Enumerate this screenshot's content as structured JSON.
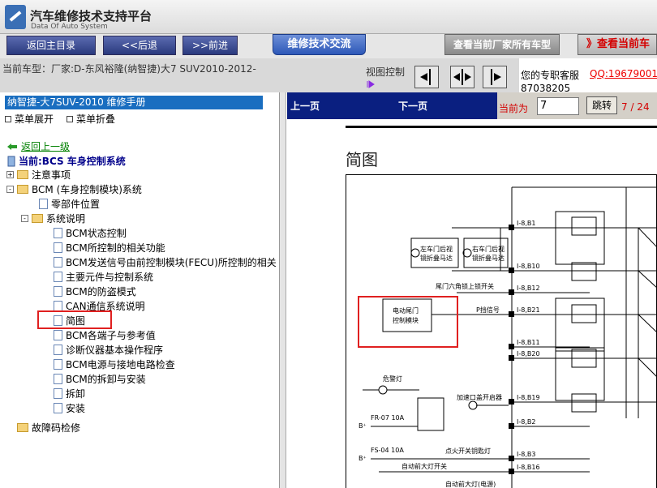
{
  "window": {
    "title": "汽车维修技术支持平台",
    "subtitle": "Data Of Auto System"
  },
  "nav": {
    "home": "返回主目录",
    "back": "<<后退",
    "forward": ">>前进",
    "exchange": "维修技术交流",
    "current_label": "查看当前厂家所有车型",
    "current_red": "》查看当前车"
  },
  "info": {
    "model": "当前车型：厂家:D-东风裕隆(纳智捷)大7 SUV2010-2012-",
    "view_control": "视图控制",
    "service": "您的专职客服",
    "qq": "QQ:196790017",
    "phone": "87038205"
  },
  "left": {
    "header": "纳智捷-大7SUV-2010 维修手册",
    "expand": "菜单展开",
    "collapse": "菜单折叠",
    "back": "返回上一级",
    "current": "当前:BCS 车身控制系统"
  },
  "tree": [
    {
      "label": "注意事项",
      "kind": "folder",
      "level": 0,
      "toggle": "+"
    },
    {
      "label": "BCM (车身控制模块)系统",
      "kind": "folder",
      "level": 0,
      "toggle": "-"
    },
    {
      "label": "零部件位置",
      "kind": "page",
      "level": 1
    },
    {
      "label": "系统说明",
      "kind": "folder",
      "level": 1,
      "toggle": "-"
    },
    {
      "label": "BCM状态控制",
      "kind": "page",
      "level": 2
    },
    {
      "label": "BCM所控制的相关功能",
      "kind": "page",
      "level": 2
    },
    {
      "label": "BCM发送信号由前控制模块(FECU)所控制的相关",
      "kind": "page",
      "level": 2
    },
    {
      "label": "主要元件与控制系统",
      "kind": "page",
      "level": 2
    },
    {
      "label": "BCM的防盗模式",
      "kind": "page",
      "level": 2
    },
    {
      "label": "CAN通信系统说明",
      "kind": "page",
      "level": 2
    },
    {
      "label": "简图",
      "kind": "page",
      "level": 2
    },
    {
      "label": "BCM各端子与参考值",
      "kind": "page",
      "level": 2
    },
    {
      "label": "诊断仪器基本操作程序",
      "kind": "page",
      "level": 2
    },
    {
      "label": "BCM电源与接地电路检查",
      "kind": "page",
      "level": 2
    },
    {
      "label": "BCM的拆卸与安装",
      "kind": "page",
      "level": 2
    },
    {
      "label": "拆卸",
      "kind": "page",
      "level": 2
    },
    {
      "label": "安装",
      "kind": "page",
      "level": 2
    },
    {
      "label": "故障码检修",
      "kind": "folder",
      "level": 0,
      "toggle": ""
    }
  ],
  "pager": {
    "prev": "上一页",
    "next": "下一页",
    "current_label": "当前为",
    "current_value": "7",
    "jump": "跳转",
    "count": "7 / 24"
  },
  "doc": {
    "title": "简图"
  },
  "diagram": {
    "pins": [
      "I-8,B1",
      "I-8,B10",
      "I-8,B12",
      "I-8,B21",
      "I-8,B11",
      "I-8,B20",
      "I-8,B19",
      "I-8,B2",
      "I-8,B3",
      "I-8,B16"
    ],
    "mirror_left": "左车门后视镜折叠马达",
    "mirror_right": "右车门后视镜折叠马达",
    "tailgate_switch": "尾门六角锁上锁开关",
    "tailgate_module": "电动尾门控制模块",
    "p_signal": "P挡信号",
    "hazard_lamp": "危警灯",
    "accel_switch": "加速口盖开启器",
    "fr07": "FR-07 10A",
    "fs04": "FS-04 10A",
    "ignition_lamp": "点火开关钥匙灯",
    "auto_light_switch": "自动前大灯开关",
    "b_plus": "B+",
    "auto_light_sensor": "自动前大灯(电源)"
  },
  "colors": {
    "accent": "#1a6ec0",
    "pager_bg": "#0a1f80",
    "highlight": "#e02020",
    "red_text": "#d40000"
  }
}
